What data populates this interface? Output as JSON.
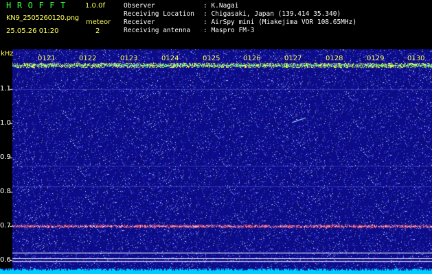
{
  "header": {
    "app_title": "HROFFT",
    "version": "1.0.0f",
    "filename": "KN9_2505260120.png",
    "meteor_label": "meteor",
    "datetime": "25.05.26 01:20",
    "meteor_count": "2"
  },
  "info": [
    {
      "key": "Observer",
      "value": ": K.Nagai"
    },
    {
      "key": "Receiving Location",
      "value": ": Chigasaki, Japan (139.414 35.340)"
    },
    {
      "key": "Receiver",
      "value": ": AirSpy mini (Miakejima VOR 108.65MHz)"
    },
    {
      "key": "Receiving antenna",
      "value": ": Maspro FM-3"
    }
  ],
  "axis": {
    "unit": "kHz",
    "ticks": [
      "1.1",
      "1.0",
      "0.9",
      "0.8",
      "0.7",
      "0.6"
    ]
  },
  "time_labels": [
    "0121",
    "0122",
    "0123",
    "0124",
    "0125",
    "0126",
    "0127",
    "0128",
    "0129",
    "0130"
  ],
  "colors": {
    "background": "#000000",
    "noise_field": "#10108a",
    "carrier_line": "#ffff55",
    "interference_line": "#ff6060",
    "floor_band": "#00ccff"
  }
}
